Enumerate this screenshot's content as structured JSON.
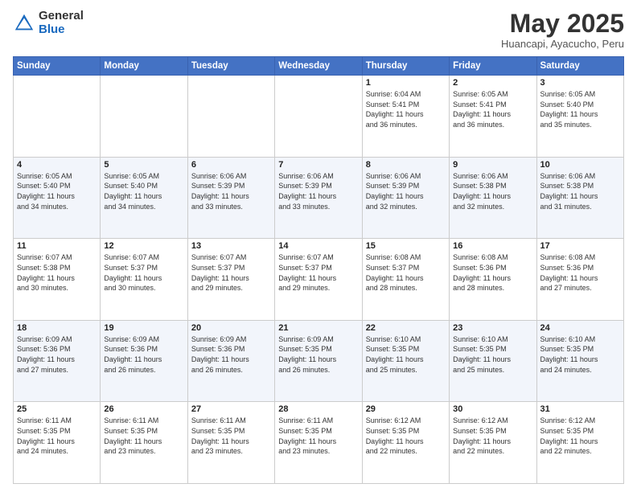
{
  "logo": {
    "general": "General",
    "blue": "Blue"
  },
  "title": "May 2025",
  "subtitle": "Huancapi, Ayacucho, Peru",
  "days_of_week": [
    "Sunday",
    "Monday",
    "Tuesday",
    "Wednesday",
    "Thursday",
    "Friday",
    "Saturday"
  ],
  "weeks": [
    [
      {
        "day": "",
        "info": ""
      },
      {
        "day": "",
        "info": ""
      },
      {
        "day": "",
        "info": ""
      },
      {
        "day": "",
        "info": ""
      },
      {
        "day": "1",
        "info": "Sunrise: 6:04 AM\nSunset: 5:41 PM\nDaylight: 11 hours\nand 36 minutes."
      },
      {
        "day": "2",
        "info": "Sunrise: 6:05 AM\nSunset: 5:41 PM\nDaylight: 11 hours\nand 36 minutes."
      },
      {
        "day": "3",
        "info": "Sunrise: 6:05 AM\nSunset: 5:40 PM\nDaylight: 11 hours\nand 35 minutes."
      }
    ],
    [
      {
        "day": "4",
        "info": "Sunrise: 6:05 AM\nSunset: 5:40 PM\nDaylight: 11 hours\nand 34 minutes."
      },
      {
        "day": "5",
        "info": "Sunrise: 6:05 AM\nSunset: 5:40 PM\nDaylight: 11 hours\nand 34 minutes."
      },
      {
        "day": "6",
        "info": "Sunrise: 6:06 AM\nSunset: 5:39 PM\nDaylight: 11 hours\nand 33 minutes."
      },
      {
        "day": "7",
        "info": "Sunrise: 6:06 AM\nSunset: 5:39 PM\nDaylight: 11 hours\nand 33 minutes."
      },
      {
        "day": "8",
        "info": "Sunrise: 6:06 AM\nSunset: 5:39 PM\nDaylight: 11 hours\nand 32 minutes."
      },
      {
        "day": "9",
        "info": "Sunrise: 6:06 AM\nSunset: 5:38 PM\nDaylight: 11 hours\nand 32 minutes."
      },
      {
        "day": "10",
        "info": "Sunrise: 6:06 AM\nSunset: 5:38 PM\nDaylight: 11 hours\nand 31 minutes."
      }
    ],
    [
      {
        "day": "11",
        "info": "Sunrise: 6:07 AM\nSunset: 5:38 PM\nDaylight: 11 hours\nand 30 minutes."
      },
      {
        "day": "12",
        "info": "Sunrise: 6:07 AM\nSunset: 5:37 PM\nDaylight: 11 hours\nand 30 minutes."
      },
      {
        "day": "13",
        "info": "Sunrise: 6:07 AM\nSunset: 5:37 PM\nDaylight: 11 hours\nand 29 minutes."
      },
      {
        "day": "14",
        "info": "Sunrise: 6:07 AM\nSunset: 5:37 PM\nDaylight: 11 hours\nand 29 minutes."
      },
      {
        "day": "15",
        "info": "Sunrise: 6:08 AM\nSunset: 5:37 PM\nDaylight: 11 hours\nand 28 minutes."
      },
      {
        "day": "16",
        "info": "Sunrise: 6:08 AM\nSunset: 5:36 PM\nDaylight: 11 hours\nand 28 minutes."
      },
      {
        "day": "17",
        "info": "Sunrise: 6:08 AM\nSunset: 5:36 PM\nDaylight: 11 hours\nand 27 minutes."
      }
    ],
    [
      {
        "day": "18",
        "info": "Sunrise: 6:09 AM\nSunset: 5:36 PM\nDaylight: 11 hours\nand 27 minutes."
      },
      {
        "day": "19",
        "info": "Sunrise: 6:09 AM\nSunset: 5:36 PM\nDaylight: 11 hours\nand 26 minutes."
      },
      {
        "day": "20",
        "info": "Sunrise: 6:09 AM\nSunset: 5:36 PM\nDaylight: 11 hours\nand 26 minutes."
      },
      {
        "day": "21",
        "info": "Sunrise: 6:09 AM\nSunset: 5:35 PM\nDaylight: 11 hours\nand 26 minutes."
      },
      {
        "day": "22",
        "info": "Sunrise: 6:10 AM\nSunset: 5:35 PM\nDaylight: 11 hours\nand 25 minutes."
      },
      {
        "day": "23",
        "info": "Sunrise: 6:10 AM\nSunset: 5:35 PM\nDaylight: 11 hours\nand 25 minutes."
      },
      {
        "day": "24",
        "info": "Sunrise: 6:10 AM\nSunset: 5:35 PM\nDaylight: 11 hours\nand 24 minutes."
      }
    ],
    [
      {
        "day": "25",
        "info": "Sunrise: 6:11 AM\nSunset: 5:35 PM\nDaylight: 11 hours\nand 24 minutes."
      },
      {
        "day": "26",
        "info": "Sunrise: 6:11 AM\nSunset: 5:35 PM\nDaylight: 11 hours\nand 23 minutes."
      },
      {
        "day": "27",
        "info": "Sunrise: 6:11 AM\nSunset: 5:35 PM\nDaylight: 11 hours\nand 23 minutes."
      },
      {
        "day": "28",
        "info": "Sunrise: 6:11 AM\nSunset: 5:35 PM\nDaylight: 11 hours\nand 23 minutes."
      },
      {
        "day": "29",
        "info": "Sunrise: 6:12 AM\nSunset: 5:35 PM\nDaylight: 11 hours\nand 22 minutes."
      },
      {
        "day": "30",
        "info": "Sunrise: 6:12 AM\nSunset: 5:35 PM\nDaylight: 11 hours\nand 22 minutes."
      },
      {
        "day": "31",
        "info": "Sunrise: 6:12 AM\nSunset: 5:35 PM\nDaylight: 11 hours\nand 22 minutes."
      }
    ]
  ]
}
